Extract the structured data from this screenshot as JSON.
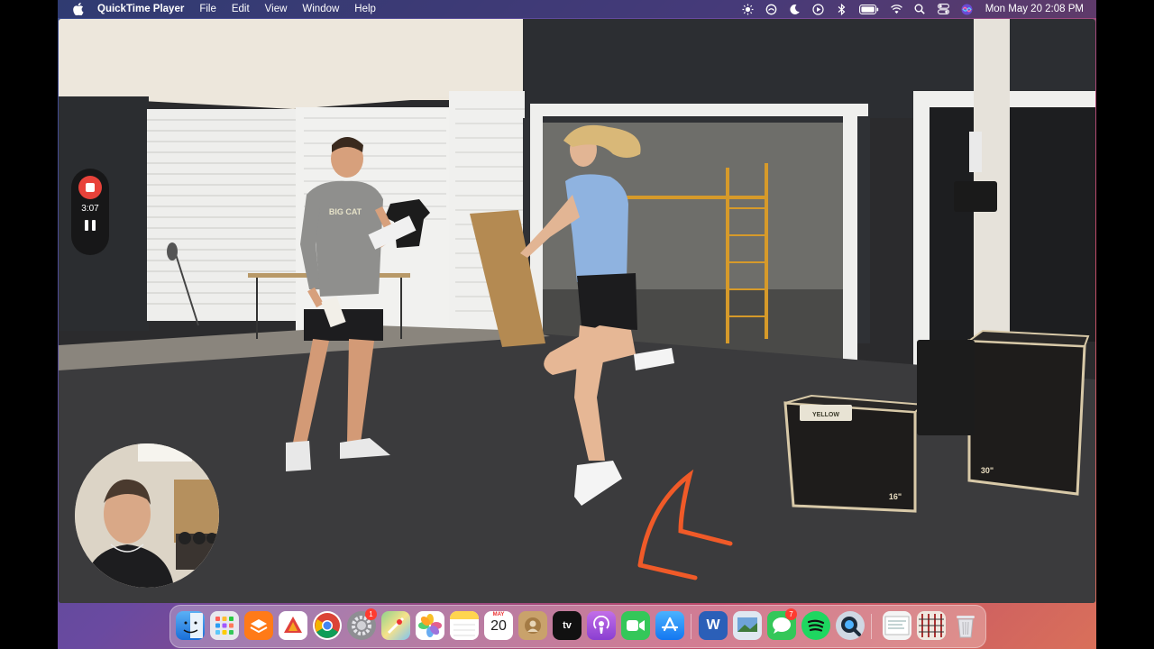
{
  "menubar": {
    "app_name": "QuickTime Player",
    "menus": [
      "File",
      "Edit",
      "View",
      "Window",
      "Help"
    ],
    "clock": "Mon May 20  2:08 PM",
    "status_icons": [
      "brightness-icon",
      "focus-icon",
      "moon-icon",
      "play-icon",
      "bluetooth-icon",
      "battery-icon",
      "wifi-icon",
      "search-icon",
      "control-center-icon",
      "siri-icon"
    ]
  },
  "recording": {
    "elapsed": "3:07"
  },
  "video": {
    "shirt_brand": "BIG CAT",
    "box_labels": [
      "16\"",
      "30\""
    ],
    "sign_text": "YELLOW"
  },
  "dock": {
    "apps": [
      {
        "name": "Finder",
        "icon": "finder-icon"
      },
      {
        "name": "Launchpad",
        "icon": "launchpad-icon"
      },
      {
        "name": "Cascade",
        "icon": "layers-icon"
      },
      {
        "name": "Affinity",
        "icon": "affinity-icon"
      },
      {
        "name": "Chrome",
        "icon": "chrome-icon"
      },
      {
        "name": "System Settings",
        "icon": "gear-icon",
        "badge": "1"
      },
      {
        "name": "Maps",
        "icon": "maps-icon"
      },
      {
        "name": "Photos",
        "icon": "photos-icon"
      },
      {
        "name": "Notes",
        "icon": "notes-icon"
      },
      {
        "name": "Calendar",
        "icon": "calendar-icon",
        "month": "MAY",
        "day": "20"
      },
      {
        "name": "Contacts",
        "icon": "contacts-icon"
      },
      {
        "name": "TV",
        "icon": "tv-icon",
        "label": "tv"
      },
      {
        "name": "Podcasts",
        "icon": "podcasts-icon"
      },
      {
        "name": "FaceTime",
        "icon": "facetime-icon"
      },
      {
        "name": "App Store",
        "icon": "appstore-icon"
      },
      {
        "name": "Word",
        "icon": "word-icon",
        "label": "W"
      },
      {
        "name": "Preview",
        "icon": "preview-icon"
      },
      {
        "name": "Messages",
        "icon": "messages-icon",
        "badge": "7"
      },
      {
        "name": "Spotify",
        "icon": "spotify-icon"
      },
      {
        "name": "QuickTime",
        "icon": "quicktime-icon"
      },
      {
        "name": "Document",
        "icon": "document-icon"
      },
      {
        "name": "Stack",
        "icon": "stack-icon"
      },
      {
        "name": "Trash",
        "icon": "trash-icon"
      }
    ]
  },
  "colors": {
    "record_red": "#e8423a",
    "hurdle_orange": "#f05a28",
    "shirt_blue": "#8fb3e0",
    "wall_dark": "#2f3236"
  }
}
